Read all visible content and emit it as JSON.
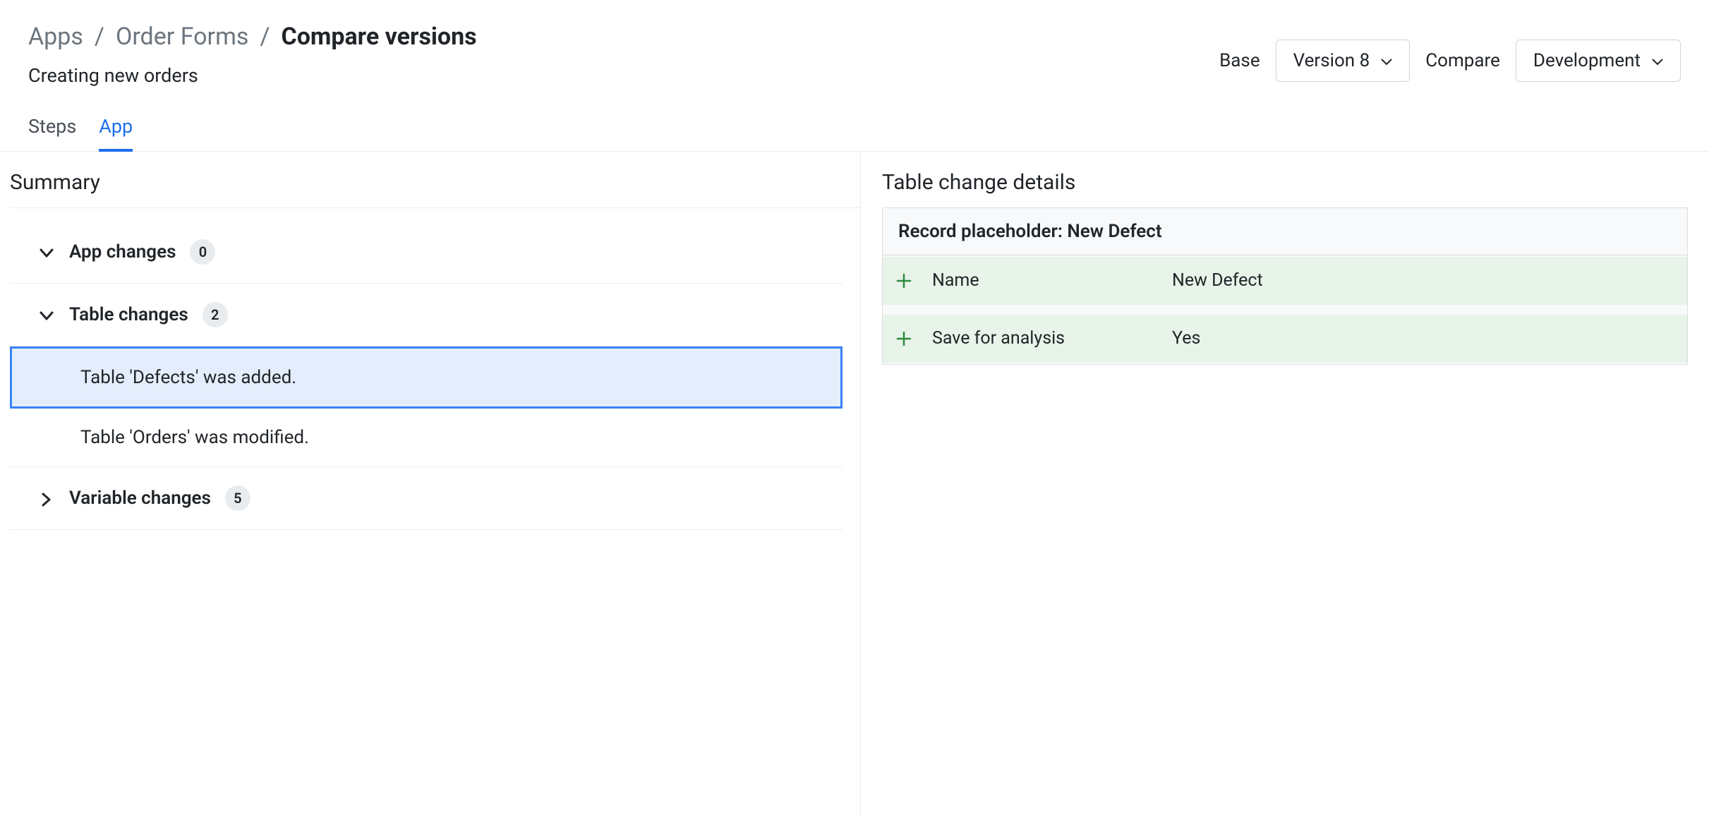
{
  "breadcrumb": {
    "apps": "Apps",
    "intermediate": "Order Forms",
    "current": "Compare versions"
  },
  "subtitle": "Creating new orders",
  "version_selectors": {
    "base_label": "Base",
    "base_value": "Version 8",
    "compare_label": "Compare",
    "compare_value": "Development"
  },
  "tabs": {
    "steps": "Steps",
    "app": "App"
  },
  "summary": {
    "title": "Summary",
    "groups": [
      {
        "label": "App changes",
        "count": "0",
        "expanded": true
      },
      {
        "label": "Table changes",
        "count": "2",
        "expanded": true
      },
      {
        "label": "Variable changes",
        "count": "5",
        "expanded": false
      }
    ],
    "table_change_items": [
      "Table 'Defects' was added.",
      "Table 'Orders' was modified."
    ]
  },
  "details": {
    "title": "Table change details",
    "header": "Record placeholder: New Defect",
    "rows": [
      {
        "name": "Name",
        "value": "New Defect"
      },
      {
        "name": "Save for analysis",
        "value": "Yes"
      }
    ]
  }
}
